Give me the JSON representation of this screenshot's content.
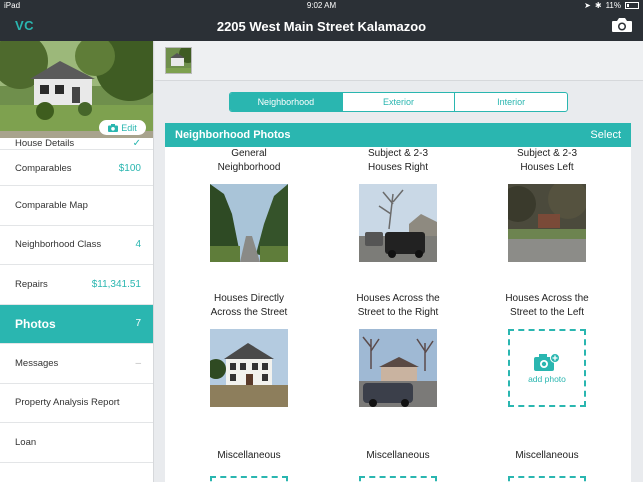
{
  "status_bar": {
    "device": "iPad",
    "time": "9:02 AM",
    "battery": "11%"
  },
  "nav": {
    "logo": "VC",
    "title": "2205 West Main Street Kalamazoo"
  },
  "sidebar": {
    "edit_label": "Edit",
    "items": [
      {
        "label": "House Details",
        "value": "✓"
      },
      {
        "label": "Comparables",
        "value": "$100"
      },
      {
        "label": "Comparable Map",
        "value": ""
      },
      {
        "label": "Neighborhood Class",
        "value": "4"
      },
      {
        "label": "Repairs",
        "value": "$11,341.51"
      },
      {
        "label": "Photos",
        "value": "7"
      },
      {
        "label": "Messages",
        "value": "–"
      },
      {
        "label": "Property Analysis Report",
        "value": ""
      },
      {
        "label": "Loan",
        "value": ""
      }
    ]
  },
  "tabs": [
    "Neighborhood",
    "Exterior",
    "Interior"
  ],
  "panel": {
    "title": "Neighborhood Photos",
    "select_label": "Select",
    "add_label": "add photo",
    "cells": [
      {
        "caption": "General Neighborhood"
      },
      {
        "caption": "Subject & 2-3 Houses Right"
      },
      {
        "caption": "Subject & 2-3 Houses Left"
      },
      {
        "caption": "Houses Directly Across the Street"
      },
      {
        "caption": "Houses Across the Street to the Right"
      },
      {
        "caption": "Houses Across the Street to the Left"
      },
      {
        "caption": "Miscellaneous"
      },
      {
        "caption": "Miscellaneous"
      },
      {
        "caption": "Miscellaneous"
      }
    ]
  },
  "colors": {
    "accent": "#2ab6b0",
    "nav_bg": "#2b3036"
  }
}
